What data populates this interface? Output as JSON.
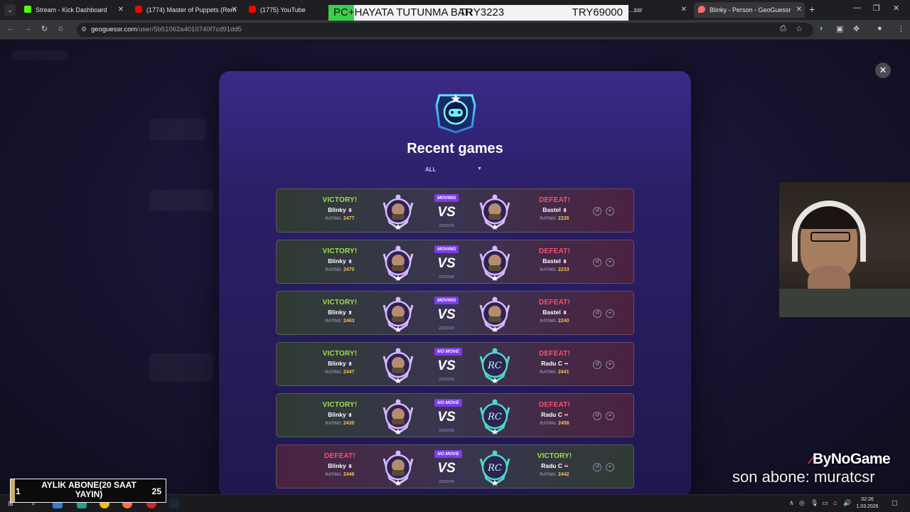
{
  "browser": {
    "tabs": [
      {
        "title": "Stream - Kick Dashboard",
        "icon": "kick-icon",
        "color": "#53fc18"
      },
      {
        "title": "(1774) Master of Puppets (Rem",
        "icon": "youtube-icon",
        "color": "#ff0000"
      },
      {
        "title": "(1775) YouTube",
        "icon": "youtube-icon",
        "color": "#ff0000"
      },
      {
        "title": "...ssr",
        "icon": "geoguessr-icon",
        "color": "#7c5cff"
      },
      {
        "title": "Blinky - Person - GeoGuessr",
        "icon": "pin-icon",
        "color": "#ff6b6b"
      }
    ],
    "url_host": "geoguessr.com",
    "url_path": "/user/5b51062a4010740f7cd91dd5"
  },
  "overlay_banner": {
    "left_text": "PC+HAYATA TUTUNMA BAR",
    "mid_text": "TRY3223",
    "right_text": "TRY69000"
  },
  "modal": {
    "title": "Recent games",
    "filter": "ALL",
    "rating_label": "RATING",
    "vs_label": "VS",
    "games": [
      {
        "left_result": "VICTORY!",
        "left_player": "Blinky",
        "left_rating": "2477",
        "mode": "MOVING",
        "date": "22/02/26",
        "right_result": "DEFEAT!",
        "right_player": "Bastel",
        "right_rating": "2226",
        "outcome": "win"
      },
      {
        "left_result": "VICTORY!",
        "left_player": "Blinky",
        "left_rating": "2470",
        "mode": "MOVING",
        "date": "22/02/26",
        "right_result": "DEFEAT!",
        "right_player": "Bastel",
        "right_rating": "2233",
        "outcome": "win"
      },
      {
        "left_result": "VICTORY!",
        "left_player": "Blinky",
        "left_rating": "2463",
        "mode": "MOVING",
        "date": "22/02/26",
        "right_result": "DEFEAT!",
        "right_player": "Bastel",
        "right_rating": "2240",
        "outcome": "win"
      },
      {
        "left_result": "VICTORY!",
        "left_player": "Blinky",
        "left_rating": "2447",
        "mode": "NO MOVE",
        "date": "22/02/26",
        "right_result": "DEFEAT!",
        "right_player": "Radu C",
        "right_rating": "2441",
        "outcome": "win"
      },
      {
        "left_result": "VICTORY!",
        "left_player": "Blinky",
        "left_rating": "2430",
        "mode": "NO MOVE",
        "date": "22/02/26",
        "right_result": "DEFEAT!",
        "right_player": "Radu C",
        "right_rating": "2458",
        "outcome": "win"
      },
      {
        "left_result": "DEFEAT!",
        "left_player": "Blinky",
        "left_rating": "2446",
        "mode": "NO MOVE",
        "date": "22/02/26",
        "right_result": "VICTORY!",
        "right_player": "Radu C",
        "right_rating": "2442",
        "outcome": "loss"
      }
    ]
  },
  "stream_overlay": {
    "brand": "ByNoGame",
    "last_sub": "son abone: muratcsr",
    "sub_goal_label": "AYLIK ABONE(20 SAAT YAYIN)",
    "sub_goal_current": "1",
    "sub_goal_target": "25"
  },
  "taskbar": {
    "time": "02:26",
    "date": "1.03.2026"
  }
}
